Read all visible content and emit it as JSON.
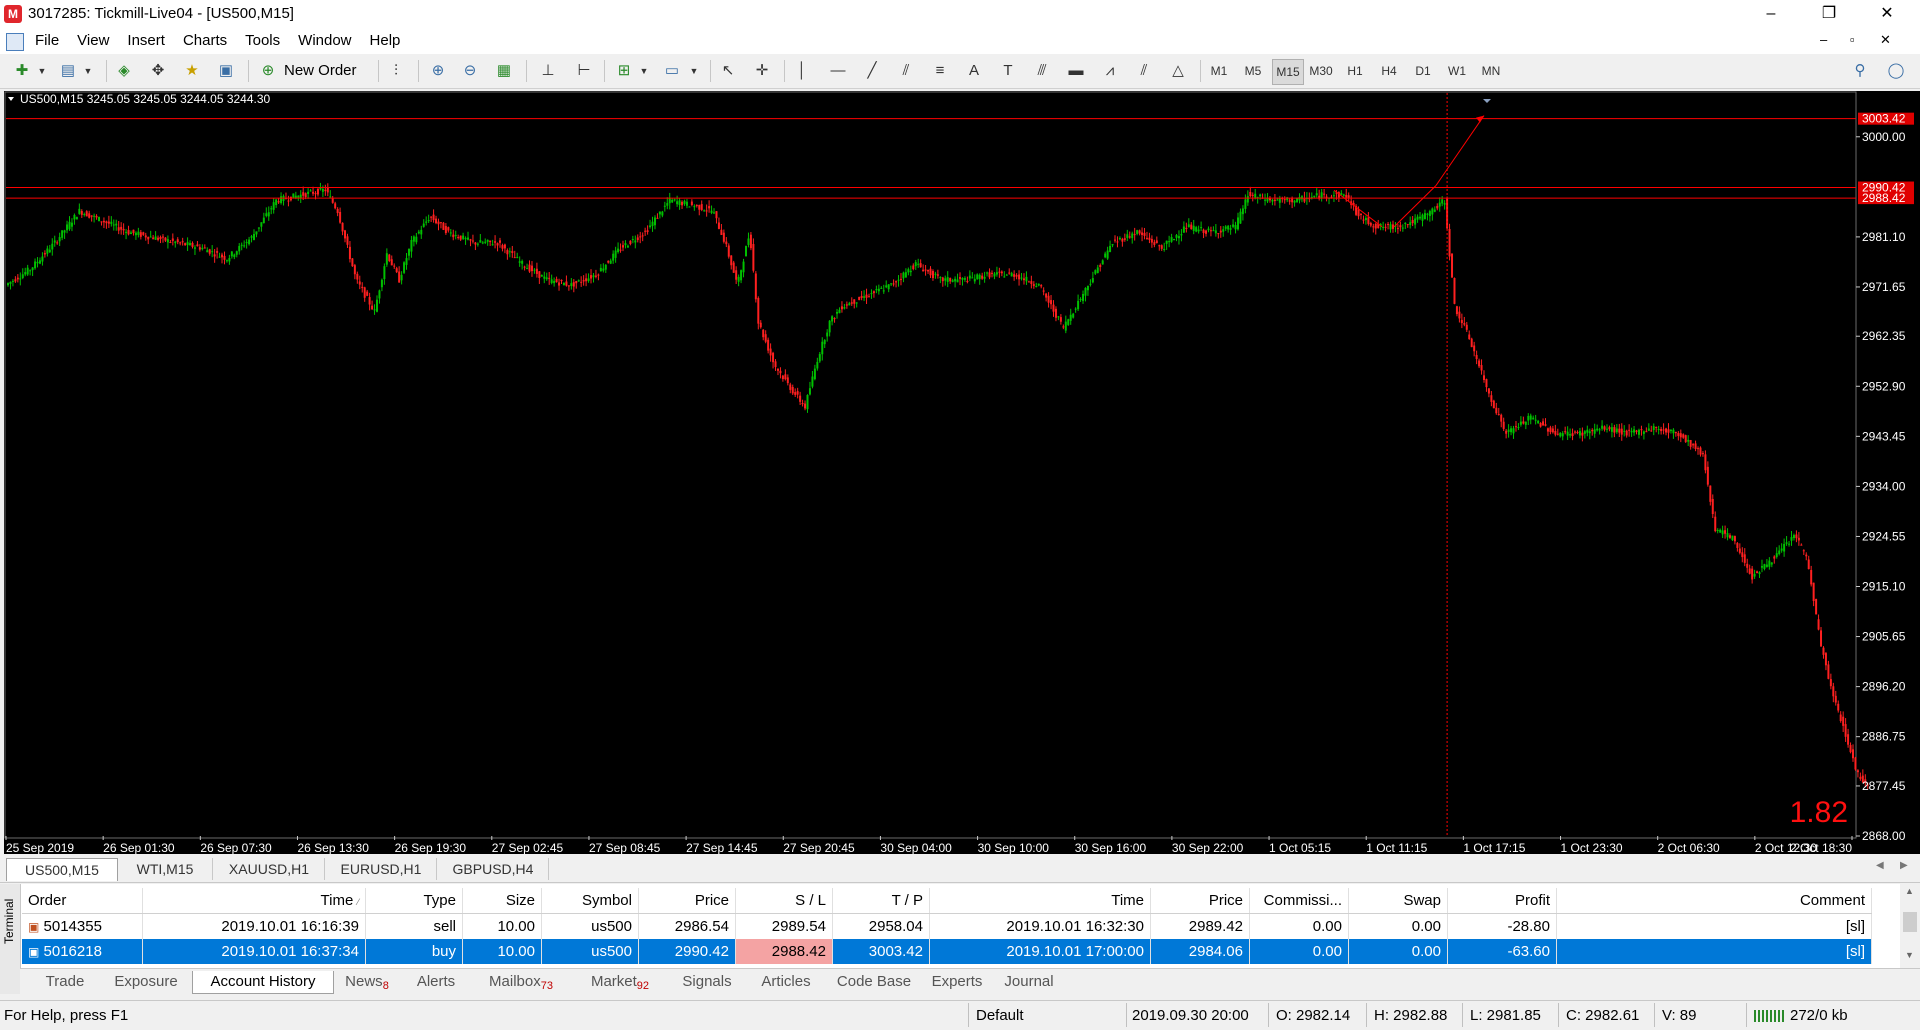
{
  "window": {
    "title": "3017285: Tickmill-Live04 - [US500,M15]",
    "app_icon": "metatrader-icon",
    "minimize": "–",
    "restore": "❐",
    "close": "✕"
  },
  "menu": [
    "File",
    "View",
    "Insert",
    "Charts",
    "Tools",
    "Window",
    "Help"
  ],
  "mdi_controls": {
    "minimize": "–",
    "restore": "▫",
    "close": "✕"
  },
  "toolbar": {
    "new_order_label": "New Order",
    "timeframes": [
      "M1",
      "M5",
      "M15",
      "M30",
      "H1",
      "H4",
      "D1",
      "W1",
      "MN"
    ],
    "active_timeframe": "M15",
    "text_tool": "A"
  },
  "chart": {
    "header": "US500,M15  3245.05 3245.05 3244.05 3244.30",
    "corner_value": "1.82",
    "price_labels": [
      {
        "text": "3003.42",
        "highlight": true
      },
      {
        "text": "3000.00"
      },
      {
        "text": "2990.42",
        "highlight": true
      },
      {
        "text": "2988.42",
        "highlight": true
      },
      {
        "text": "2981.10"
      },
      {
        "text": "2971.65"
      },
      {
        "text": "2962.35"
      },
      {
        "text": "2952.90"
      },
      {
        "text": "2943.45"
      },
      {
        "text": "2934.00"
      },
      {
        "text": "2924.55"
      },
      {
        "text": "2915.10"
      },
      {
        "text": "2905.65"
      },
      {
        "text": "2896.20"
      },
      {
        "text": "2886.75"
      },
      {
        "text": "2877.45"
      },
      {
        "text": "2868.00"
      }
    ],
    "time_labels": [
      "25 Sep 2019",
      "26 Sep 01:30",
      "26 Sep 07:30",
      "26 Sep 13:30",
      "26 Sep 19:30",
      "27 Sep 02:45",
      "27 Sep 08:45",
      "27 Sep 14:45",
      "27 Sep 20:45",
      "30 Sep 04:00",
      "30 Sep 10:00",
      "30 Sep 16:00",
      "30 Sep 22:00",
      "1 Oct 05:15",
      "1 Oct 11:15",
      "1 Oct 17:15",
      "1 Oct 23:30",
      "2 Oct 06:30",
      "2 Oct 12:30",
      "2 Oct 18:30"
    ],
    "bull_color": "#00c000",
    "bear_color": "#ff2020",
    "line_color": "#ff0000"
  },
  "chart_data": {
    "type": "candlestick",
    "symbol": "US500",
    "timeframe": "M15",
    "ylim": [
      2868.0,
      3006.0
    ],
    "trend_path": [
      [
        0,
        2972
      ],
      [
        20,
        2975
      ],
      [
        40,
        2980
      ],
      [
        60,
        2986
      ],
      [
        80,
        2984
      ],
      [
        100,
        2982
      ],
      [
        120,
        2981
      ],
      [
        140,
        2980
      ],
      [
        160,
        2979
      ],
      [
        180,
        2977
      ],
      [
        200,
        2981
      ],
      [
        220,
        2988
      ],
      [
        240,
        2989
      ],
      [
        260,
        2990
      ],
      [
        270,
        2986
      ],
      [
        285,
        2973
      ],
      [
        300,
        2967
      ],
      [
        310,
        2978
      ],
      [
        320,
        2973
      ],
      [
        330,
        2980
      ],
      [
        345,
        2985
      ],
      [
        360,
        2982
      ],
      [
        380,
        2980
      ],
      [
        400,
        2980
      ],
      [
        420,
        2976
      ],
      [
        440,
        2973
      ],
      [
        460,
        2972
      ],
      [
        480,
        2974
      ],
      [
        500,
        2979
      ],
      [
        520,
        2982
      ],
      [
        540,
        2988
      ],
      [
        560,
        2987
      ],
      [
        575,
        2986
      ],
      [
        585,
        2980
      ],
      [
        595,
        2972
      ],
      [
        605,
        2982
      ],
      [
        612,
        2965
      ],
      [
        625,
        2957
      ],
      [
        640,
        2952
      ],
      [
        650,
        2949
      ],
      [
        660,
        2958
      ],
      [
        670,
        2965
      ],
      [
        680,
        2968
      ],
      [
        700,
        2970
      ],
      [
        720,
        2972
      ],
      [
        740,
        2976
      ],
      [
        760,
        2973
      ],
      [
        780,
        2973
      ],
      [
        800,
        2974
      ],
      [
        820,
        2974
      ],
      [
        840,
        2972
      ],
      [
        860,
        2964
      ],
      [
        880,
        2972
      ],
      [
        900,
        2980
      ],
      [
        920,
        2982
      ],
      [
        940,
        2979
      ],
      [
        960,
        2983
      ],
      [
        980,
        2982
      ],
      [
        1000,
        2983
      ],
      [
        1010,
        2989
      ],
      [
        1030,
        2988
      ],
      [
        1050,
        2988
      ],
      [
        1070,
        2989
      ],
      [
        1090,
        2989
      ],
      [
        1100,
        2985
      ],
      [
        1115,
        2983
      ],
      [
        1130,
        2983
      ],
      [
        1145,
        2984
      ],
      [
        1160,
        2986
      ],
      [
        1170,
        2988
      ],
      [
        1178,
        2968
      ],
      [
        1190,
        2962
      ],
      [
        1205,
        2952
      ],
      [
        1220,
        2944
      ],
      [
        1240,
        2947
      ],
      [
        1260,
        2944
      ],
      [
        1280,
        2944
      ],
      [
        1300,
        2945
      ],
      [
        1320,
        2944
      ],
      [
        1340,
        2945
      ],
      [
        1360,
        2944
      ],
      [
        1380,
        2940
      ],
      [
        1390,
        2926
      ],
      [
        1405,
        2924
      ],
      [
        1420,
        2917
      ],
      [
        1440,
        2921
      ],
      [
        1455,
        2925
      ],
      [
        1465,
        2920
      ],
      [
        1475,
        2905
      ],
      [
        1485,
        2895
      ],
      [
        1495,
        2888
      ],
      [
        1505,
        2880
      ],
      [
        1512,
        2878
      ]
    ]
  },
  "chart_tabs": [
    "US500,M15",
    "WTI,M15",
    "XAUUSD,H1",
    "EURUSD,H1",
    "GBPUSD,H4"
  ],
  "history": {
    "columns": [
      "Order",
      "Time",
      "Type",
      "Size",
      "Symbol",
      "Price",
      "S / L",
      "T / P",
      "Time",
      "Price",
      "Commissi...",
      "Swap",
      "Profit",
      "Comment"
    ],
    "rows": [
      [
        "5014355",
        "2019.10.01 16:16:39",
        "sell",
        "10.00",
        "us500",
        "2986.54",
        "2989.54",
        "2958.04",
        "2019.10.01 16:32:30",
        "2989.42",
        "0.00",
        "0.00",
        "-28.80",
        "[sl]"
      ],
      [
        "5016218",
        "2019.10.01 16:37:34",
        "buy",
        "10.00",
        "us500",
        "2990.42",
        "2988.42",
        "3003.42",
        "2019.10.01 17:00:00",
        "2984.06",
        "0.00",
        "0.00",
        "-63.60",
        "[sl]"
      ]
    ]
  },
  "terminal_label": "Terminal",
  "terminal_tabs": [
    {
      "label": "Trade"
    },
    {
      "label": "Exposure"
    },
    {
      "label": "Account History",
      "active": true
    },
    {
      "label": "News",
      "badge": "8"
    },
    {
      "label": "Alerts"
    },
    {
      "label": "Mailbox",
      "badge": "73"
    },
    {
      "label": "Market",
      "badge": "92"
    },
    {
      "label": "Signals"
    },
    {
      "label": "Articles"
    },
    {
      "label": "Code Base"
    },
    {
      "label": "Experts"
    },
    {
      "label": "Journal"
    }
  ],
  "status": {
    "help": "For Help, press F1",
    "profile": "Default",
    "datetime": "2019.09.30 20:00",
    "open": "O: 2982.14",
    "high": "H: 2982.88",
    "low": "L: 2981.85",
    "close": "C: 2982.61",
    "volume": "V: 89",
    "traffic": "272/0 kb"
  }
}
